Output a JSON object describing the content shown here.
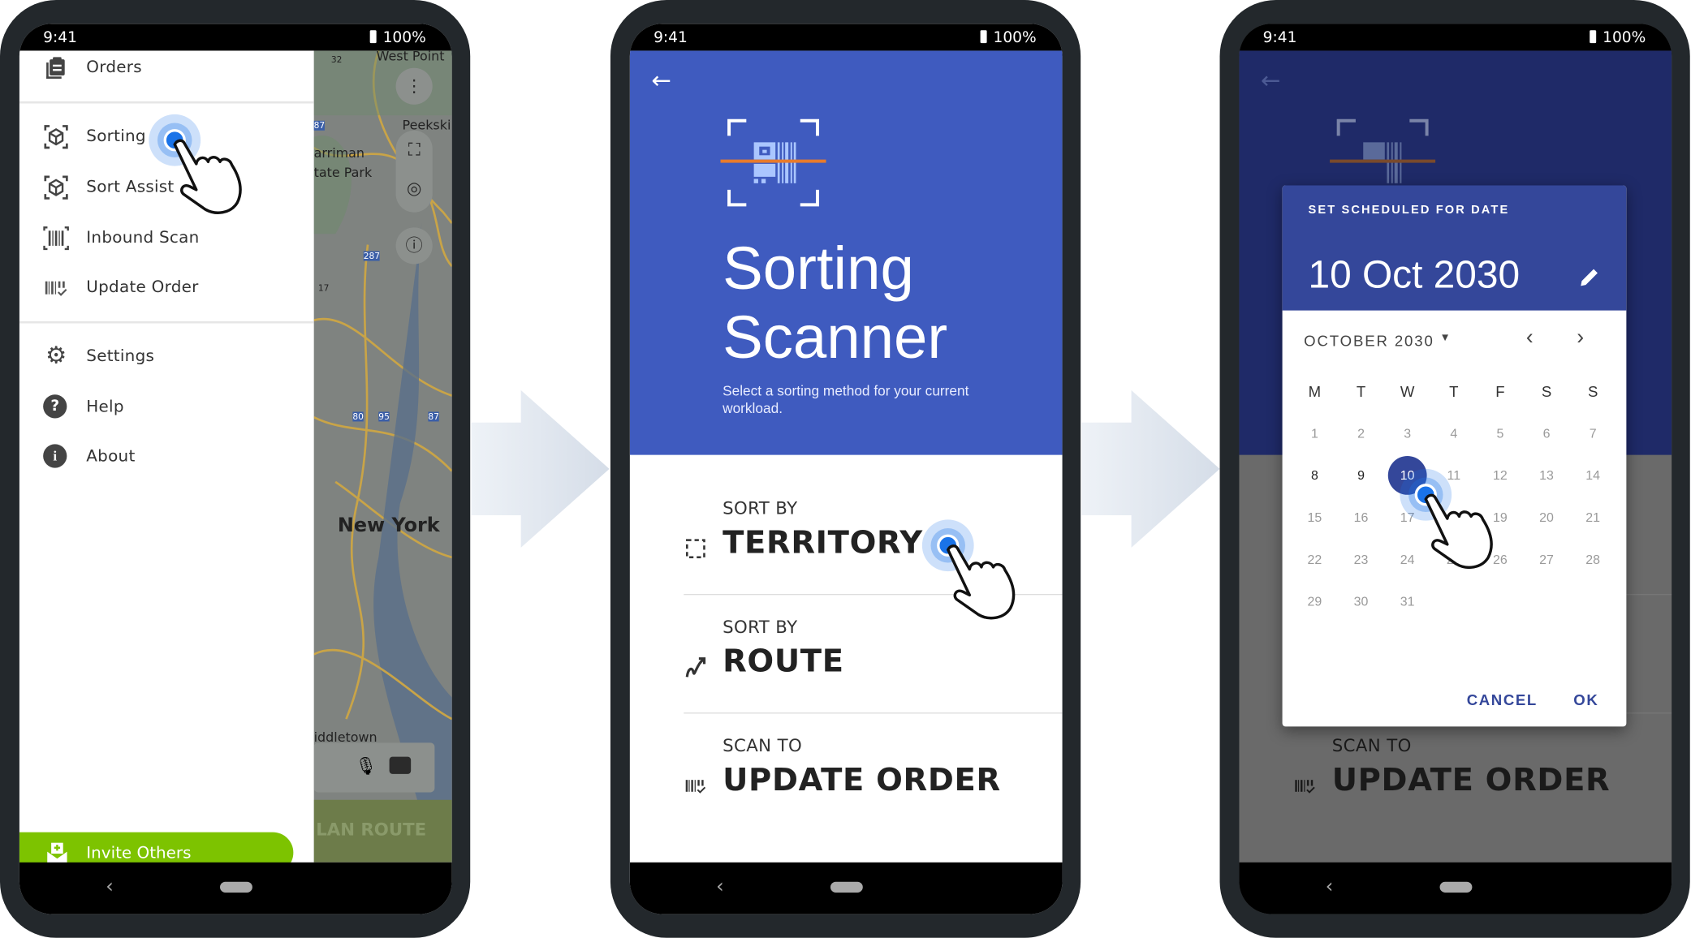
{
  "status_bar": {
    "time": "9:41",
    "battery": "100%"
  },
  "colors": {
    "brand_blue": "#3f5bbf",
    "dialog_blue": "#34479a",
    "invite_green": "#7dc300",
    "selected_day": "#34479a",
    "phone_frame": "#23282c",
    "tap_dot": "#1a73e8"
  },
  "phone1": {
    "drawer": {
      "items": [
        {
          "label": "Orders",
          "icon": "clipboard-icon"
        },
        {
          "label": "Sorting",
          "icon": "cube-scan-icon"
        },
        {
          "label": "Sort Assist",
          "icon": "cube-scan-icon"
        },
        {
          "label": "Inbound Scan",
          "icon": "barcode-scan-icon"
        },
        {
          "label": "Update Order",
          "icon": "barcode-check-icon"
        },
        {
          "label": "Settings",
          "icon": "gear-icon"
        },
        {
          "label": "Help",
          "icon": "help-icon"
        },
        {
          "label": "About",
          "icon": "info-icon"
        }
      ],
      "invite_label": "Invite Others"
    },
    "map": {
      "labels": [
        "West Point",
        "Peekski",
        "arriman",
        "tate Park",
        "New York",
        "iddletown"
      ],
      "route_shields": [
        "32",
        "87",
        "287",
        "17",
        "80",
        "95",
        "87"
      ],
      "plan_route_label": "LAN ROUTE"
    }
  },
  "phone2": {
    "title_line1": "Sorting",
    "title_line2": "Scanner",
    "subtitle": "Select a sorting method for your current workload.",
    "options": [
      {
        "label": "SORT BY",
        "value": "TERRITORY",
        "icon": "territory-select-icon"
      },
      {
        "label": "SORT BY",
        "value": "ROUTE",
        "icon": "route-icon"
      },
      {
        "label": "SCAN TO",
        "value": "UPDATE ORDER",
        "icon": "barcode-check-icon"
      }
    ]
  },
  "phone3": {
    "dialog": {
      "title": "SET SCHEDULED FOR DATE",
      "selected_date": "10 Oct 2030",
      "month_label": "OCTOBER 2030",
      "weekdays": [
        "M",
        "T",
        "W",
        "T",
        "F",
        "S",
        "S"
      ],
      "days": [
        "1",
        "2",
        "3",
        "4",
        "5",
        "6",
        "7",
        "8",
        "9",
        "10",
        "11",
        "12",
        "13",
        "14",
        "15",
        "16",
        "17",
        "18",
        "19",
        "20",
        "21",
        "22",
        "23",
        "24",
        "25",
        "26",
        "27",
        "28",
        "29",
        "30",
        "31"
      ],
      "selected_day": "10",
      "enabled_days": [
        "8",
        "9",
        "10"
      ],
      "cancel_label": "CANCEL",
      "ok_label": "OK"
    },
    "background_option": {
      "label": "SCAN TO",
      "value": "UPDATE ORDER"
    }
  }
}
